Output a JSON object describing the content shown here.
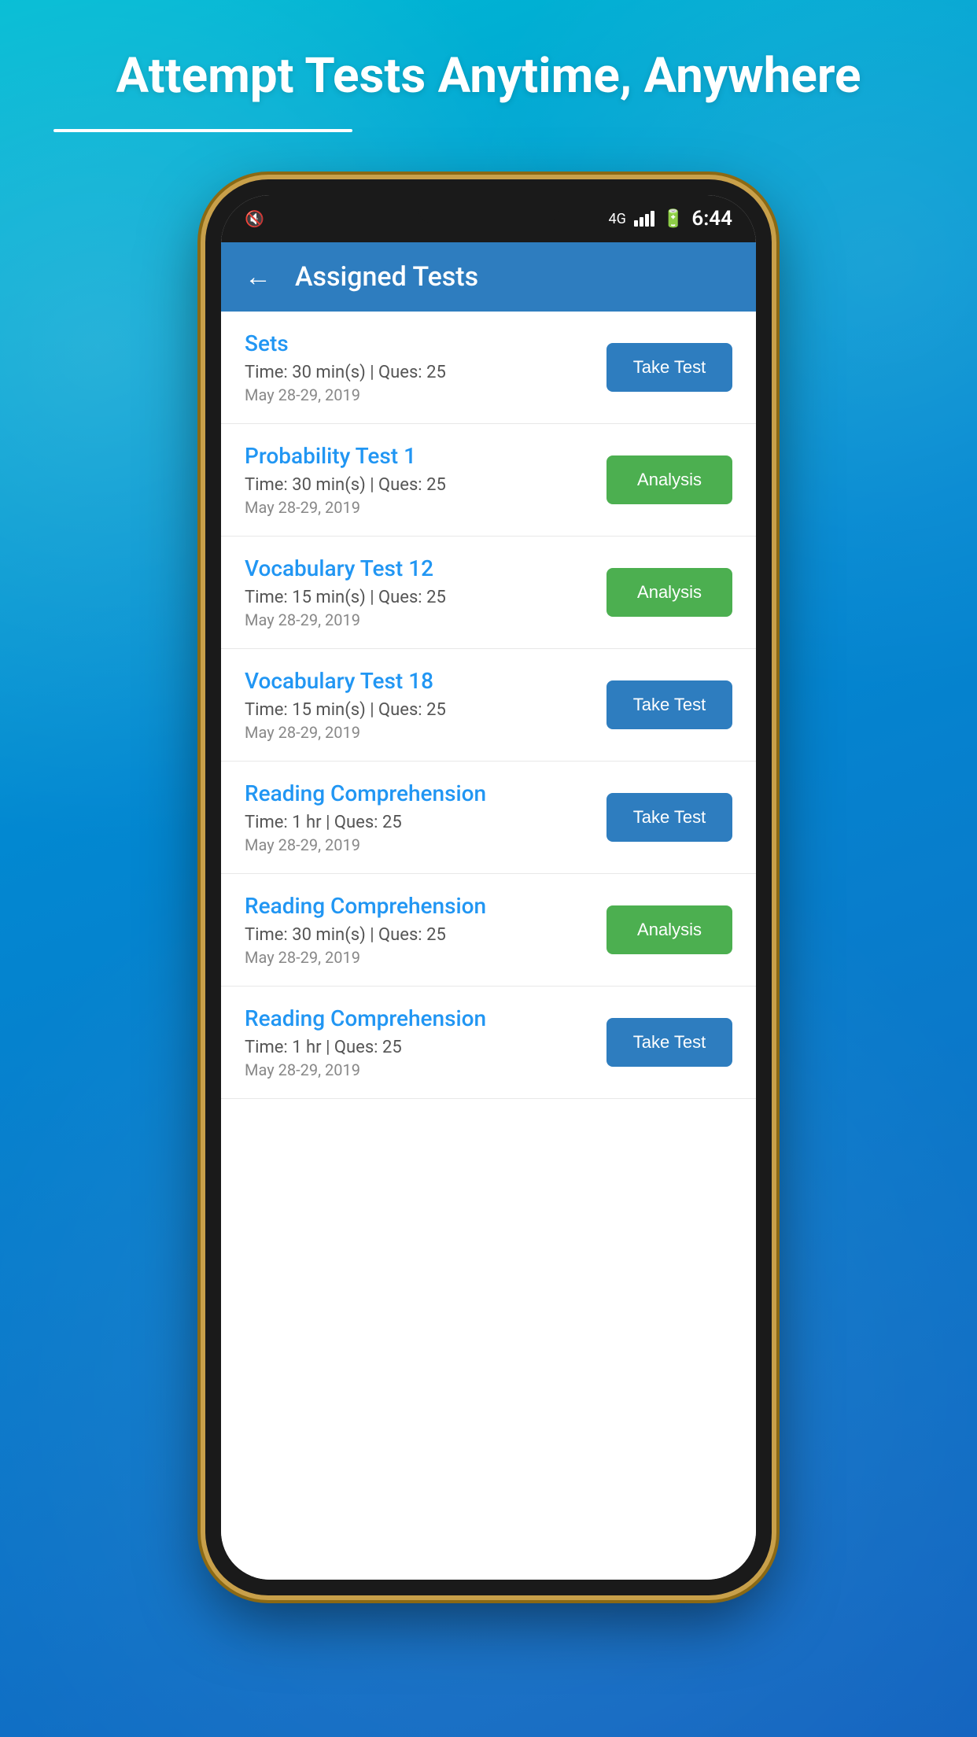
{
  "hero": {
    "title": "Attempt Tests Anytime, Anywhere"
  },
  "statusBar": {
    "time": "6:44",
    "network": "4G"
  },
  "header": {
    "title": "Assigned Tests",
    "backLabel": "←"
  },
  "tests": [
    {
      "id": 1,
      "name": "Sets",
      "time": "Time: 30 min(s) | Ques: 25",
      "date": "May 28-29, 2019",
      "buttonLabel": "Take Test",
      "buttonType": "take"
    },
    {
      "id": 2,
      "name": "Probability Test 1",
      "time": "Time: 30 min(s) | Ques: 25",
      "date": "May 28-29, 2019",
      "buttonLabel": "Analysis",
      "buttonType": "analysis"
    },
    {
      "id": 3,
      "name": "Vocabulary Test 12",
      "time": "Time: 15 min(s) | Ques: 25",
      "date": "May 28-29, 2019",
      "buttonLabel": "Analysis",
      "buttonType": "analysis"
    },
    {
      "id": 4,
      "name": "Vocabulary Test 18",
      "time": "Time: 15 min(s) | Ques: 25",
      "date": "May 28-29, 2019",
      "buttonLabel": "Take Test",
      "buttonType": "take"
    },
    {
      "id": 5,
      "name": "Reading Comprehension",
      "time": "Time: 1 hr | Ques: 25",
      "date": "May 28-29, 2019",
      "buttonLabel": "Take Test",
      "buttonType": "take"
    },
    {
      "id": 6,
      "name": "Reading Comprehension",
      "time": "Time: 30 min(s) | Ques: 25",
      "date": "May 28-29, 2019",
      "buttonLabel": "Analysis",
      "buttonType": "analysis"
    },
    {
      "id": 7,
      "name": "Reading Comprehension",
      "time": "Time: 1 hr | Ques: 25",
      "date": "May 28-29, 2019",
      "buttonLabel": "Take Test",
      "buttonType": "take"
    }
  ]
}
